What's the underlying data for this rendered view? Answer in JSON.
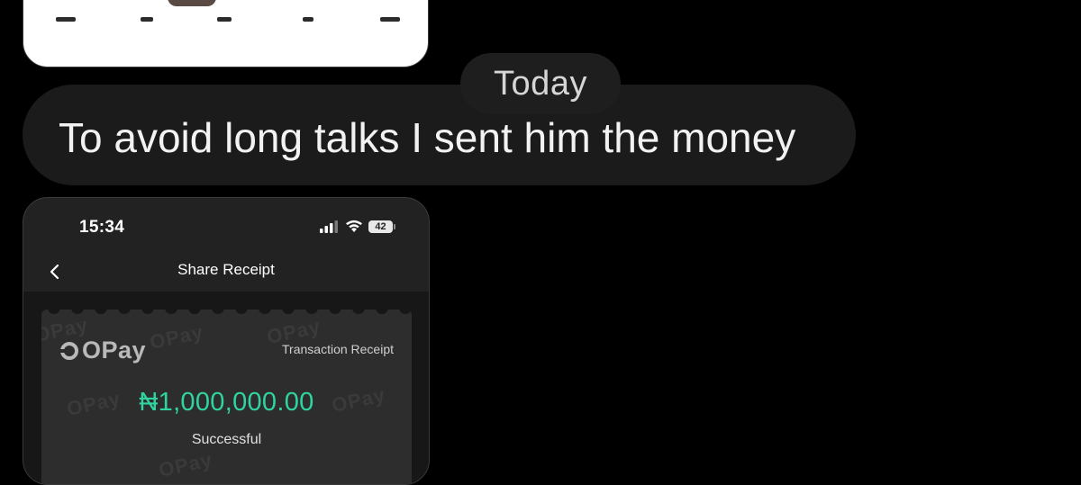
{
  "separator": {
    "day_label": "Today"
  },
  "message": {
    "text": "To avoid long talks I sent him the money"
  },
  "screenshot": {
    "status_bar": {
      "time": "15:34",
      "battery_level": "42",
      "icons": [
        "signal-icon",
        "wifi-icon",
        "battery-icon"
      ]
    },
    "nav": {
      "title": "Share Receipt",
      "back_icon": "chevron-left-icon"
    },
    "receipt": {
      "brand": "OPay",
      "label": "Transaction Receipt",
      "amount": "₦1,000,000.00",
      "status": "Successful",
      "watermark": "OPay"
    }
  },
  "colors": {
    "background": "#000000",
    "bubble": "#1b1b1b",
    "day_pill": "#1e1e1e",
    "amount_green": "#2fd4a0",
    "receipt_bg": "#2d2d2d"
  }
}
